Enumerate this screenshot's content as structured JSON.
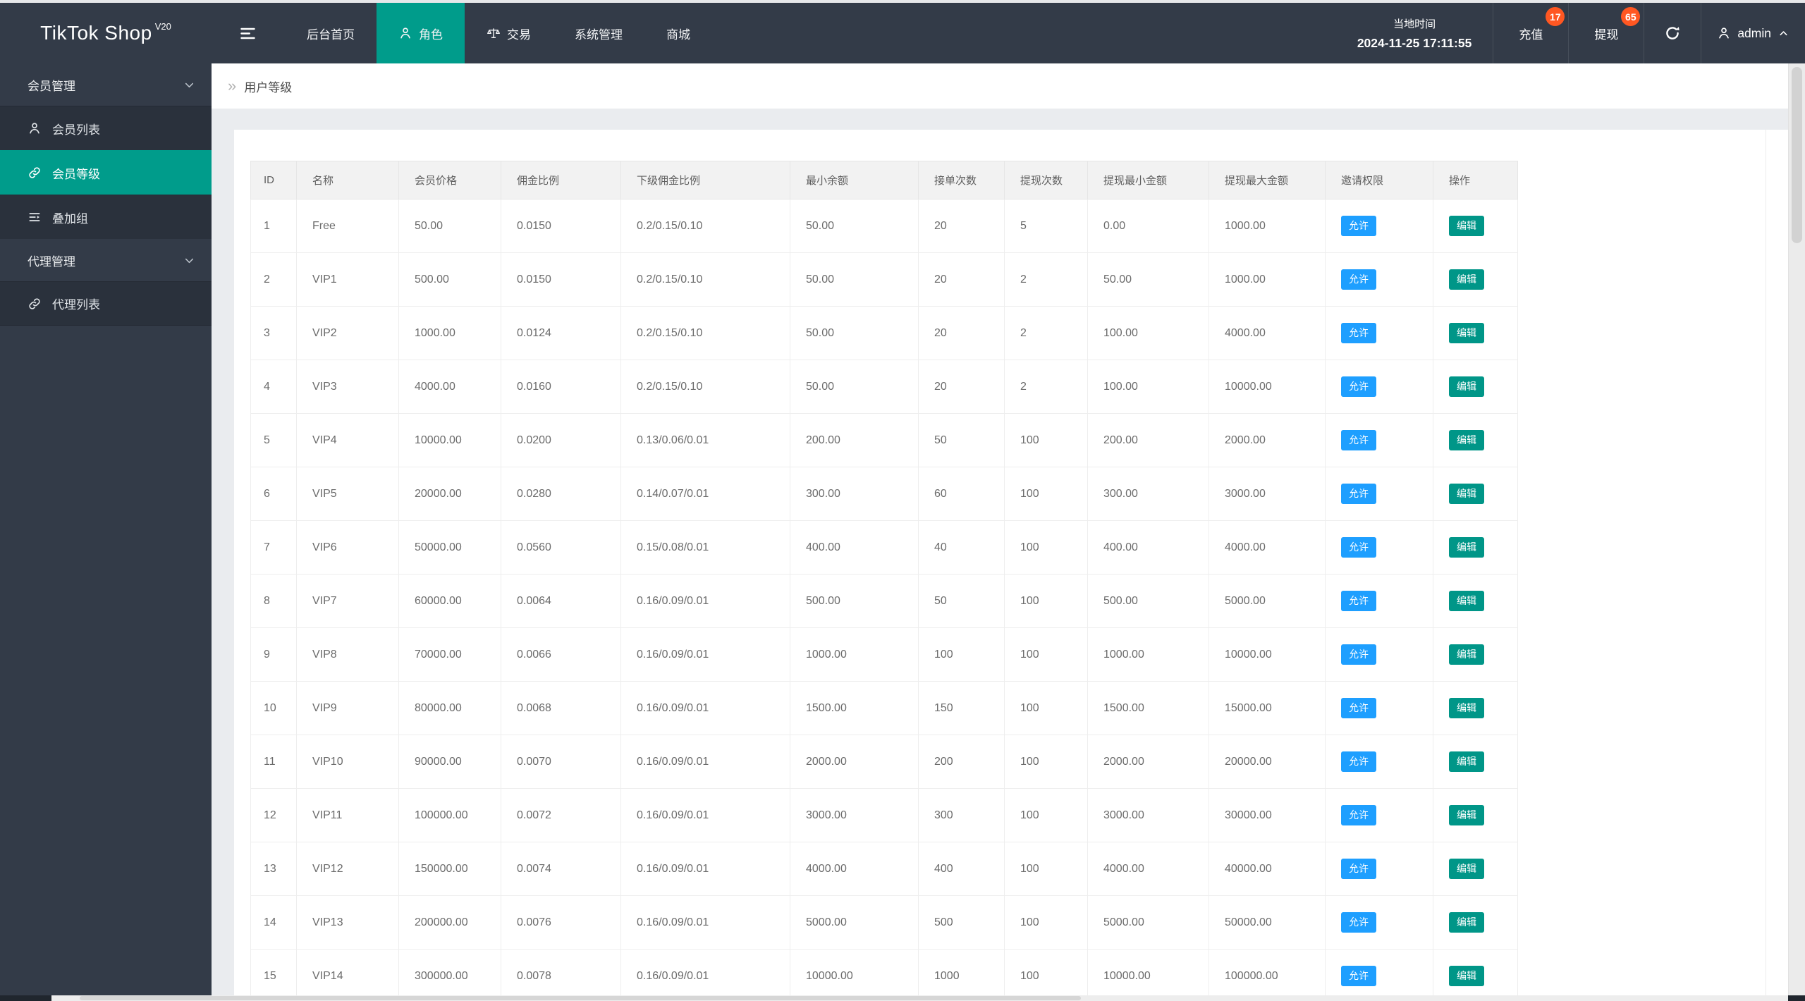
{
  "brand": {
    "title": "TikTok Shop",
    "superscript": "V20"
  },
  "topnav": {
    "items": [
      {
        "label": "后台首页",
        "icon": "",
        "active": false
      },
      {
        "label": "角色",
        "icon": "user",
        "active": true
      },
      {
        "label": "交易",
        "icon": "scales",
        "active": false
      },
      {
        "label": "系统管理",
        "icon": "",
        "active": false
      },
      {
        "label": "商城",
        "icon": "",
        "active": false
      }
    ]
  },
  "userbar": {
    "local_time_label": "当地时间",
    "local_time_value": "2024-11-25 17:11:55",
    "recharge_label": "充值",
    "recharge_badge": "17",
    "withdraw_label": "提现",
    "withdraw_badge": "65",
    "username": "admin"
  },
  "sidebar": {
    "groups": [
      {
        "label": "会员管理",
        "items": [
          {
            "label": "会员列表",
            "icon": "user",
            "active": false
          },
          {
            "label": "会员等级",
            "icon": "link",
            "active": true
          },
          {
            "label": "叠加组",
            "icon": "layers",
            "active": false
          }
        ]
      },
      {
        "label": "代理管理",
        "items": [
          {
            "label": "代理列表",
            "icon": "link",
            "active": false
          }
        ]
      }
    ]
  },
  "breadcrumb": {
    "title": "用户等级"
  },
  "table": {
    "headers": [
      "ID",
      "名称",
      "会员价格",
      "佣金比例",
      "下级佣金比例",
      "最小余额",
      "接单次数",
      "提现次数",
      "提现最小金额",
      "提现最大金额",
      "邀请权限",
      "操作"
    ],
    "allow_label": "允许",
    "edit_label": "编辑",
    "rows": [
      {
        "id": "1",
        "name": "Free",
        "price": "50.00",
        "commission": "0.0150",
        "sub_commission": "0.2/0.15/0.10",
        "min_balance": "50.00",
        "order_count": "20",
        "withdraw_count": "5",
        "withdraw_min": "0.00",
        "withdraw_max": "1000.00"
      },
      {
        "id": "2",
        "name": "VIP1",
        "price": "500.00",
        "commission": "0.0150",
        "sub_commission": "0.2/0.15/0.10",
        "min_balance": "50.00",
        "order_count": "20",
        "withdraw_count": "2",
        "withdraw_min": "50.00",
        "withdraw_max": "1000.00"
      },
      {
        "id": "3",
        "name": "VIP2",
        "price": "1000.00",
        "commission": "0.0124",
        "sub_commission": "0.2/0.15/0.10",
        "min_balance": "50.00",
        "order_count": "20",
        "withdraw_count": "2",
        "withdraw_min": "100.00",
        "withdraw_max": "4000.00"
      },
      {
        "id": "4",
        "name": "VIP3",
        "price": "4000.00",
        "commission": "0.0160",
        "sub_commission": "0.2/0.15/0.10",
        "min_balance": "50.00",
        "order_count": "20",
        "withdraw_count": "2",
        "withdraw_min": "100.00",
        "withdraw_max": "10000.00"
      },
      {
        "id": "5",
        "name": "VIP4",
        "price": "10000.00",
        "commission": "0.0200",
        "sub_commission": "0.13/0.06/0.01",
        "min_balance": "200.00",
        "order_count": "50",
        "withdraw_count": "100",
        "withdraw_min": "200.00",
        "withdraw_max": "2000.00"
      },
      {
        "id": "6",
        "name": "VIP5",
        "price": "20000.00",
        "commission": "0.0280",
        "sub_commission": "0.14/0.07/0.01",
        "min_balance": "300.00",
        "order_count": "60",
        "withdraw_count": "100",
        "withdraw_min": "300.00",
        "withdraw_max": "3000.00"
      },
      {
        "id": "7",
        "name": "VIP6",
        "price": "50000.00",
        "commission": "0.0560",
        "sub_commission": "0.15/0.08/0.01",
        "min_balance": "400.00",
        "order_count": "40",
        "withdraw_count": "100",
        "withdraw_min": "400.00",
        "withdraw_max": "4000.00"
      },
      {
        "id": "8",
        "name": "VIP7",
        "price": "60000.00",
        "commission": "0.0064",
        "sub_commission": "0.16/0.09/0.01",
        "min_balance": "500.00",
        "order_count": "50",
        "withdraw_count": "100",
        "withdraw_min": "500.00",
        "withdraw_max": "5000.00"
      },
      {
        "id": "9",
        "name": "VIP8",
        "price": "70000.00",
        "commission": "0.0066",
        "sub_commission": "0.16/0.09/0.01",
        "min_balance": "1000.00",
        "order_count": "100",
        "withdraw_count": "100",
        "withdraw_min": "1000.00",
        "withdraw_max": "10000.00"
      },
      {
        "id": "10",
        "name": "VIP9",
        "price": "80000.00",
        "commission": "0.0068",
        "sub_commission": "0.16/0.09/0.01",
        "min_balance": "1500.00",
        "order_count": "150",
        "withdraw_count": "100",
        "withdraw_min": "1500.00",
        "withdraw_max": "15000.00"
      },
      {
        "id": "11",
        "name": "VIP10",
        "price": "90000.00",
        "commission": "0.0070",
        "sub_commission": "0.16/0.09/0.01",
        "min_balance": "2000.00",
        "order_count": "200",
        "withdraw_count": "100",
        "withdraw_min": "2000.00",
        "withdraw_max": "20000.00"
      },
      {
        "id": "12",
        "name": "VIP11",
        "price": "100000.00",
        "commission": "0.0072",
        "sub_commission": "0.16/0.09/0.01",
        "min_balance": "3000.00",
        "order_count": "300",
        "withdraw_count": "100",
        "withdraw_min": "3000.00",
        "withdraw_max": "30000.00"
      },
      {
        "id": "13",
        "name": "VIP12",
        "price": "150000.00",
        "commission": "0.0074",
        "sub_commission": "0.16/0.09/0.01",
        "min_balance": "4000.00",
        "order_count": "400",
        "withdraw_count": "100",
        "withdraw_min": "4000.00",
        "withdraw_max": "40000.00"
      },
      {
        "id": "14",
        "name": "VIP13",
        "price": "200000.00",
        "commission": "0.0076",
        "sub_commission": "0.16/0.09/0.01",
        "min_balance": "5000.00",
        "order_count": "500",
        "withdraw_count": "100",
        "withdraw_min": "5000.00",
        "withdraw_max": "50000.00"
      },
      {
        "id": "15",
        "name": "VIP14",
        "price": "300000.00",
        "commission": "0.0078",
        "sub_commission": "0.16/0.09/0.01",
        "min_balance": "10000.00",
        "order_count": "1000",
        "withdraw_count": "100",
        "withdraw_min": "10000.00",
        "withdraw_max": "100000.00"
      }
    ]
  },
  "colors": {
    "accent_teal": "#009c8b",
    "button_green": "#009688",
    "button_blue": "#1e9fff",
    "badge_orange": "#ff5722",
    "header_dark": "#333b48",
    "submenu_dark": "#2a313c"
  }
}
